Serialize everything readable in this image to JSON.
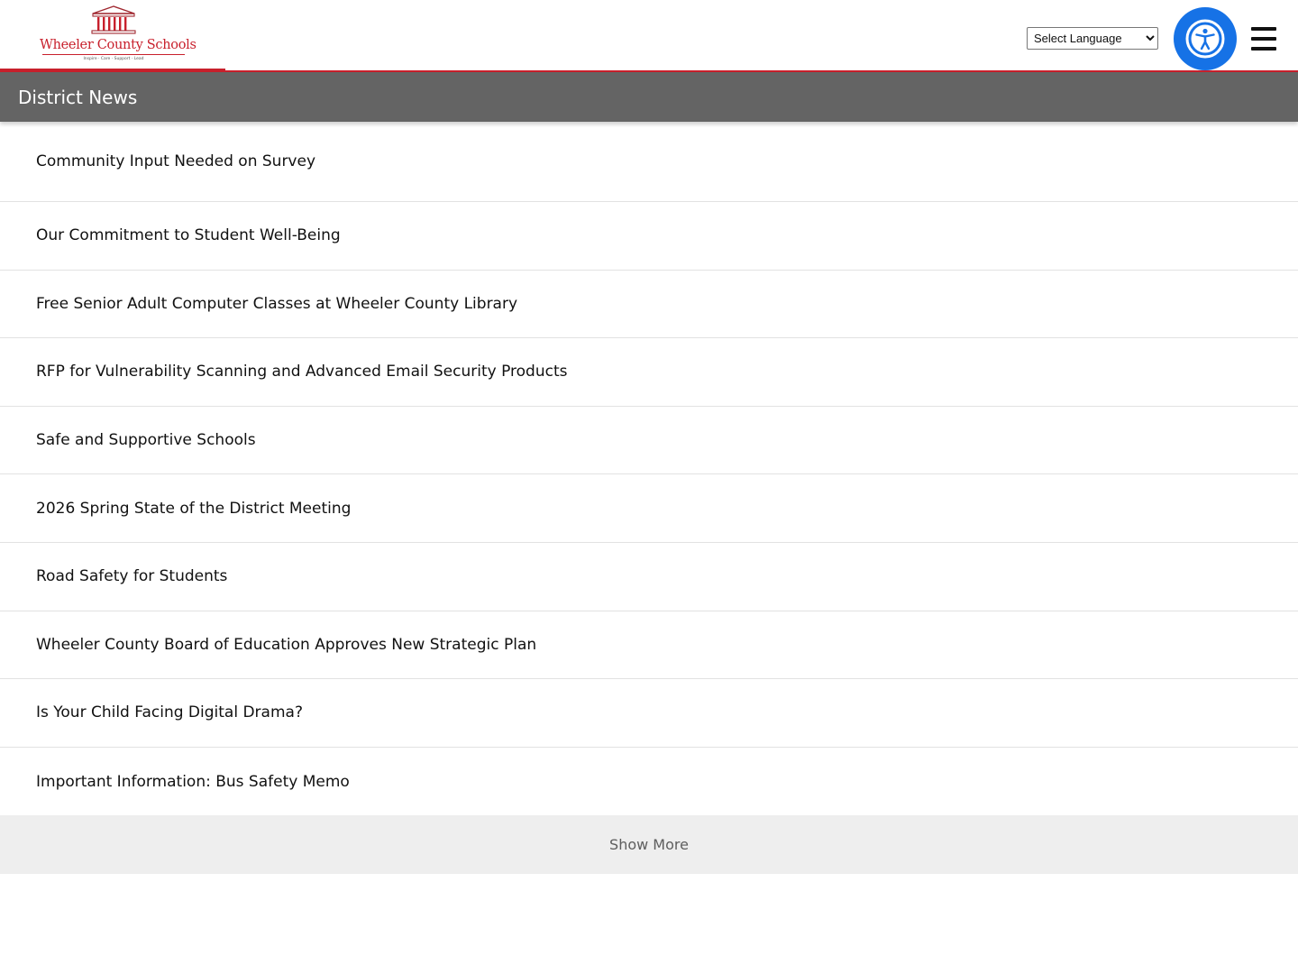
{
  "header": {
    "logo": {
      "name": "Wheeler County Schools",
      "tagline": "Inspire · Care · Support · Lead"
    },
    "language_select": {
      "selected": "Select Language"
    },
    "accessibility_icon": "accessibility-person-icon",
    "menu_icon": "hamburger-menu-icon"
  },
  "section": {
    "title": "District News"
  },
  "news": [
    {
      "title": "Community Input Needed on Survey"
    },
    {
      "title": "Our Commitment to Student Well-Being"
    },
    {
      "title": "Free Senior Adult Computer Classes at Wheeler County Library"
    },
    {
      "title": "RFP for Vulnerability Scanning and Advanced Email Security Products"
    },
    {
      "title": "Safe and Supportive Schools"
    },
    {
      "title": "2026 Spring State of the District Meeting"
    },
    {
      "title": "Road Safety for Students"
    },
    {
      "title": "Wheeler County Board of Education Approves New Strategic Plan"
    },
    {
      "title": "Is Your Child Facing Digital Drama?"
    },
    {
      "title": "Important Information: Bus Safety Memo"
    }
  ],
  "show_more": {
    "label": "Show More"
  },
  "colors": {
    "brand_red": "#c8202c",
    "section_bar": "#646464",
    "accessibility_blue": "#1672e6",
    "show_more_bg": "#eeeeee"
  }
}
